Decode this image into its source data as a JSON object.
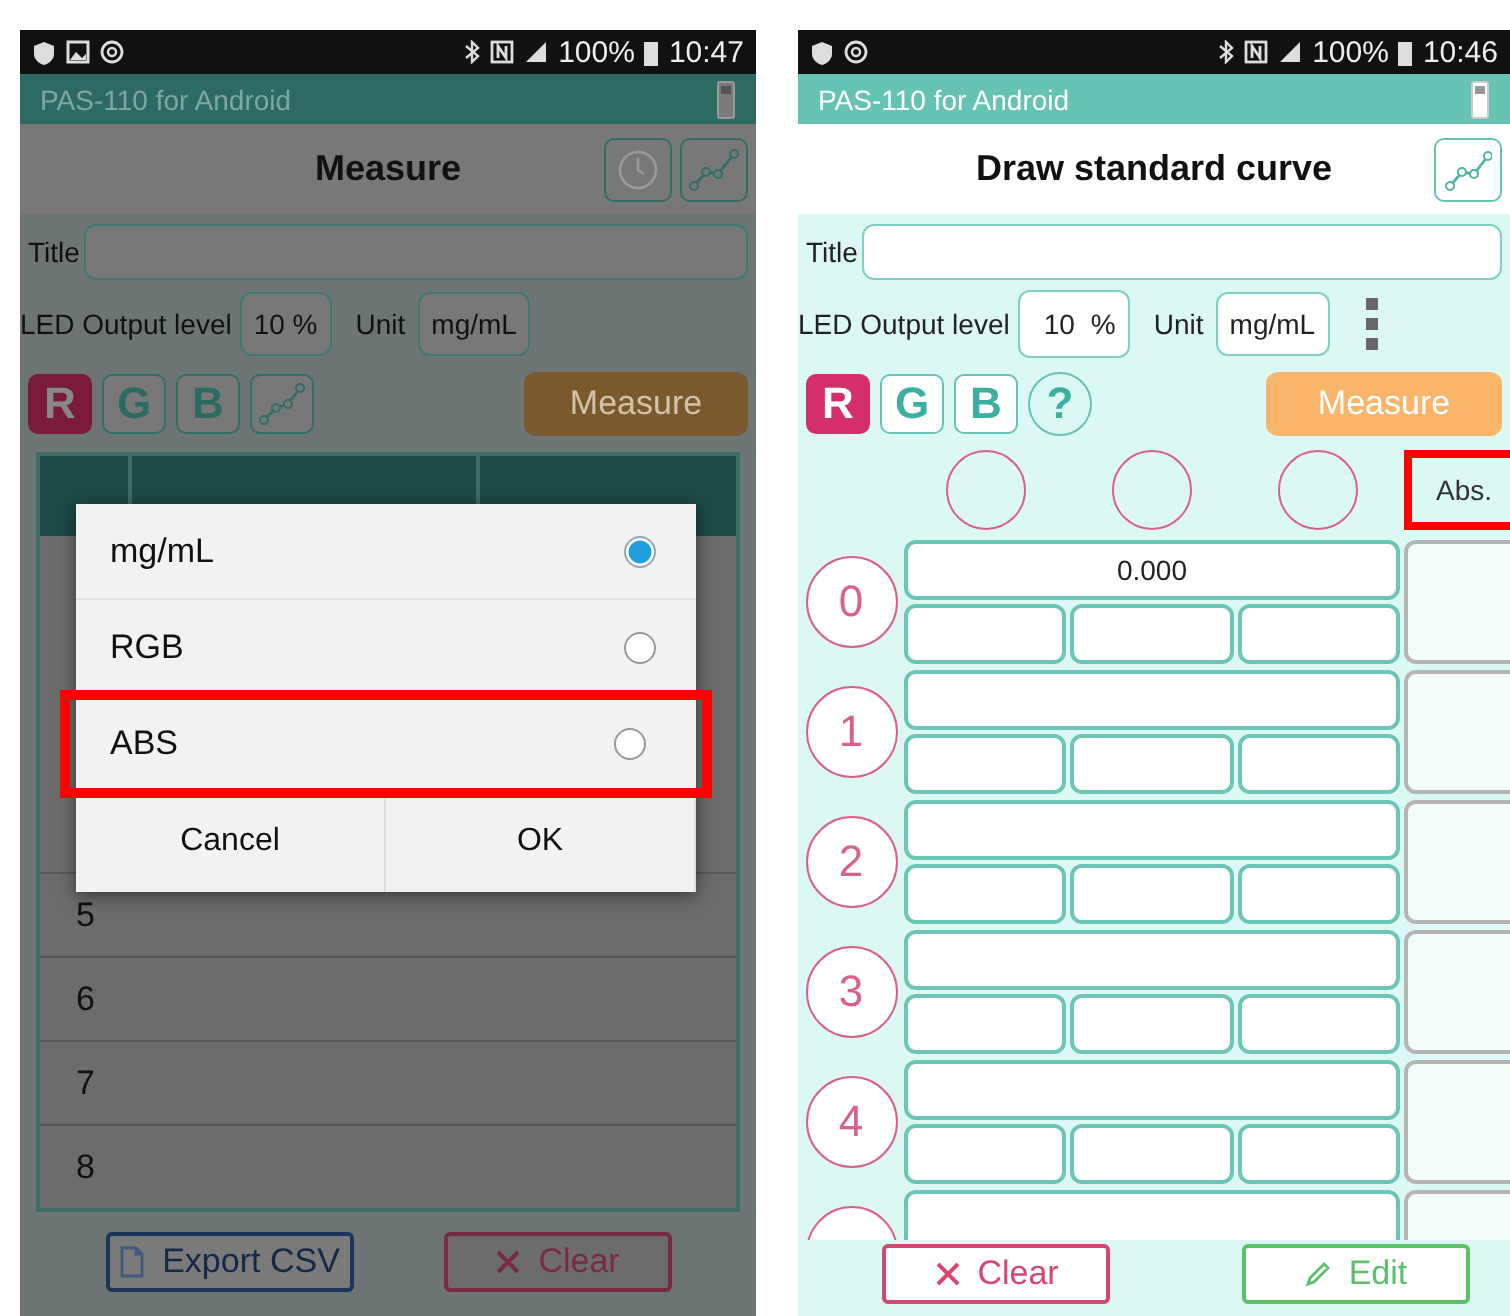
{
  "measure_screen": {
    "status_bar": {
      "battery": "100%",
      "time": "10:47"
    },
    "app_title": "PAS-110 for Android",
    "header": "Measure",
    "title_label": "Title",
    "led_label": "LED Output level",
    "led_value": "10 %",
    "unit_label": "Unit",
    "unit_value": "mg/mL",
    "color_buttons": [
      {
        "label": "R",
        "selected": true
      },
      {
        "label": "G",
        "selected": false
      },
      {
        "label": "B",
        "selected": false
      }
    ],
    "measure_button": "Measure",
    "rows": [
      "5",
      "6",
      "7",
      "8"
    ],
    "dialog": {
      "options": [
        {
          "label": "mg/mL",
          "selected": true,
          "highlighted": false
        },
        {
          "label": "RGB",
          "selected": false,
          "highlighted": false
        },
        {
          "label": "ABS",
          "selected": false,
          "highlighted": true
        }
      ],
      "buttons": [
        "Cancel",
        "OK"
      ]
    },
    "bottom_buttons": [
      {
        "label": "Export CSV",
        "kind": "export"
      },
      {
        "label": "Clear",
        "kind": "clear"
      }
    ]
  },
  "curve_screen": {
    "status_bar": {
      "battery": "100%",
      "time": "10:46"
    },
    "app_title": "PAS-110 for Android",
    "header": "Draw standard curve",
    "title_label": "Title",
    "led_label": "LED Output level",
    "led_value": "10",
    "led_unit": "%",
    "unit_label": "Unit",
    "unit_value": "mg/mL",
    "color_buttons": [
      {
        "label": "R",
        "selected": true
      },
      {
        "label": "G",
        "selected": false
      },
      {
        "label": "B",
        "selected": false
      }
    ],
    "help_button": "?",
    "measure_button": "Measure",
    "abs_header": {
      "label": "Abs.",
      "highlighted": true
    },
    "rows": [
      {
        "index": "0",
        "value": "0.000"
      },
      {
        "index": "1"
      },
      {
        "index": "2"
      },
      {
        "index": "3"
      },
      {
        "index": "4"
      },
      {}
    ],
    "bottom_buttons": [
      {
        "label": "Clear",
        "kind": "clear"
      },
      {
        "label": "Edit",
        "kind": "edit"
      }
    ]
  }
}
